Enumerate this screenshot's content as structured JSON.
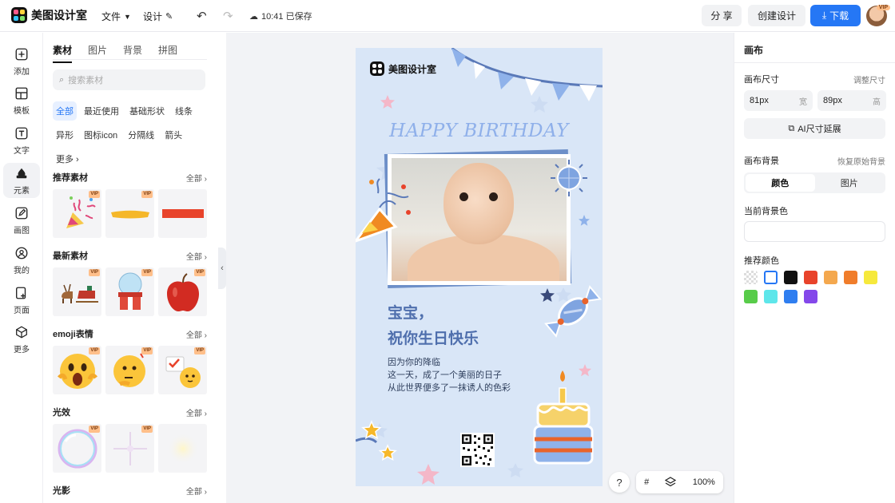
{
  "app": {
    "name": "美图设计室"
  },
  "topbar": {
    "file_label": "文件",
    "design_label": "设计",
    "save_status": "10:41 已保存",
    "share_label": "分 享",
    "create_label": "创建设计",
    "download_label": "下载",
    "avatar_badge": "VIP"
  },
  "rail": [
    {
      "label": "添加",
      "icon": "plus-square-icon"
    },
    {
      "label": "模板",
      "icon": "template-icon"
    },
    {
      "label": "文字",
      "icon": "text-icon"
    },
    {
      "label": "元素",
      "icon": "shapes-icon",
      "active": true
    },
    {
      "label": "画图",
      "icon": "pencil-icon"
    },
    {
      "label": "我的",
      "icon": "user-icon"
    },
    {
      "label": "页面",
      "icon": "page-icon"
    },
    {
      "label": "更多",
      "icon": "cube-icon"
    }
  ],
  "panel": {
    "tabs": [
      "素材",
      "图片",
      "背景",
      "拼图"
    ],
    "search_placeholder": "搜索素材",
    "chips": [
      "全部",
      "最近使用",
      "基础形状",
      "线条",
      "异形",
      "图标icon",
      "分隔线",
      "箭头",
      "更多"
    ],
    "sections": [
      {
        "title": "推荐素材",
        "all": "全部",
        "vip": [
          "VIP",
          "VIP",
          ""
        ]
      },
      {
        "title": "最新素材",
        "all": "全部",
        "vip": [
          "VIP",
          "VIP",
          "VIP"
        ]
      },
      {
        "title": "emoji表情",
        "all": "全部",
        "vip": [
          "VIP",
          "VIP",
          "VIP"
        ]
      },
      {
        "title": "光效",
        "all": "全部",
        "vip": [
          "VIP",
          "VIP",
          ""
        ]
      },
      {
        "title": "光影",
        "all": "全部",
        "vip": []
      }
    ]
  },
  "canvas": {
    "logo_text": "美图设计室",
    "headline": "HAPPY BIRTHDAY",
    "title_line1": "宝宝，",
    "title_line2": "祝你生日快乐",
    "body_line1": "因为你的降临",
    "body_line2": "这一天，成了一个美丽的日子",
    "body_line3": "从此世界便多了一抹诱人的色彩",
    "bg_color": "#d9e6f7"
  },
  "stage_tools": {
    "help": "?",
    "zoom": "100%"
  },
  "right": {
    "title": "画布",
    "size_label": "画布尺寸",
    "size_link": "调整尺寸",
    "width_value": "81px",
    "width_unit": "宽",
    "height_value": "89px",
    "height_unit": "高",
    "ai_extend": "AI尺寸延展",
    "bg_label": "画布背景",
    "bg_link": "恢复原始背景",
    "seg_color": "颜色",
    "seg_image": "图片",
    "current_bg_label": "当前背景色",
    "rec_label": "推荐颜色",
    "swatches": [
      "transparent",
      "#ffffff",
      "#111111",
      "#e8432b",
      "#f4a84e",
      "#f07d2b",
      "#f6e93c",
      "#58cc4a",
      "#5ee6ea",
      "#2f7ef0",
      "#8448ea"
    ]
  }
}
